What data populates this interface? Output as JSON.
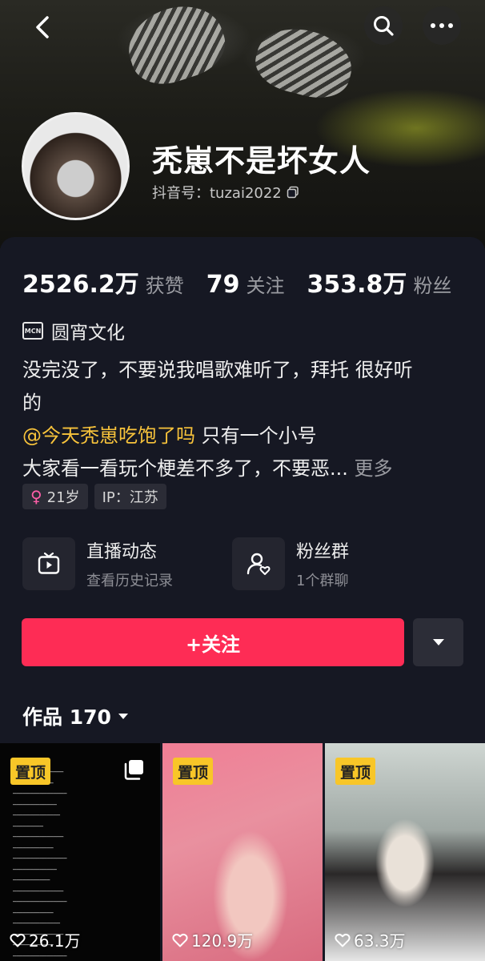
{
  "header": {
    "nickname": "秃崽不是坏女人",
    "account_id": "抖音号：tuzai2022"
  },
  "stats": [
    {
      "value": "2526.2万",
      "label": "获赞"
    },
    {
      "value": "79",
      "label": "关注"
    },
    {
      "value": "353.8万",
      "label": "粉丝"
    }
  ],
  "mcn": {
    "badge": "MCN",
    "name": "圆宵文化"
  },
  "bio": {
    "line1": "没完没了，不要说我唱歌难听了，拜托 很好听",
    "line2": "的",
    "mention": "@今天秃崽吃饱了吗",
    "line3_rest": " 只有一个小号",
    "line4": "大家看一看玩个梗差不多了，不要恶...",
    "more": " 更多"
  },
  "tags": {
    "age": "21岁",
    "ip": "IP：江苏"
  },
  "features": {
    "live": {
      "title": "直播动态",
      "sub": "查看历史记录"
    },
    "fans": {
      "title": "粉丝群",
      "sub": "1个群聊"
    }
  },
  "follow": {
    "label": "+关注"
  },
  "works": {
    "label": "作品 170"
  },
  "videos": [
    {
      "pinned": "置顶",
      "likes": "26.1万"
    },
    {
      "pinned": "置顶",
      "likes": "120.9万"
    },
    {
      "pinned": "置顶",
      "likes": "63.3万"
    }
  ],
  "colors": {
    "accent": "#fe2c55",
    "background": "#161823",
    "mention": "#f8c33b",
    "pin_badge": "#f8c628"
  }
}
